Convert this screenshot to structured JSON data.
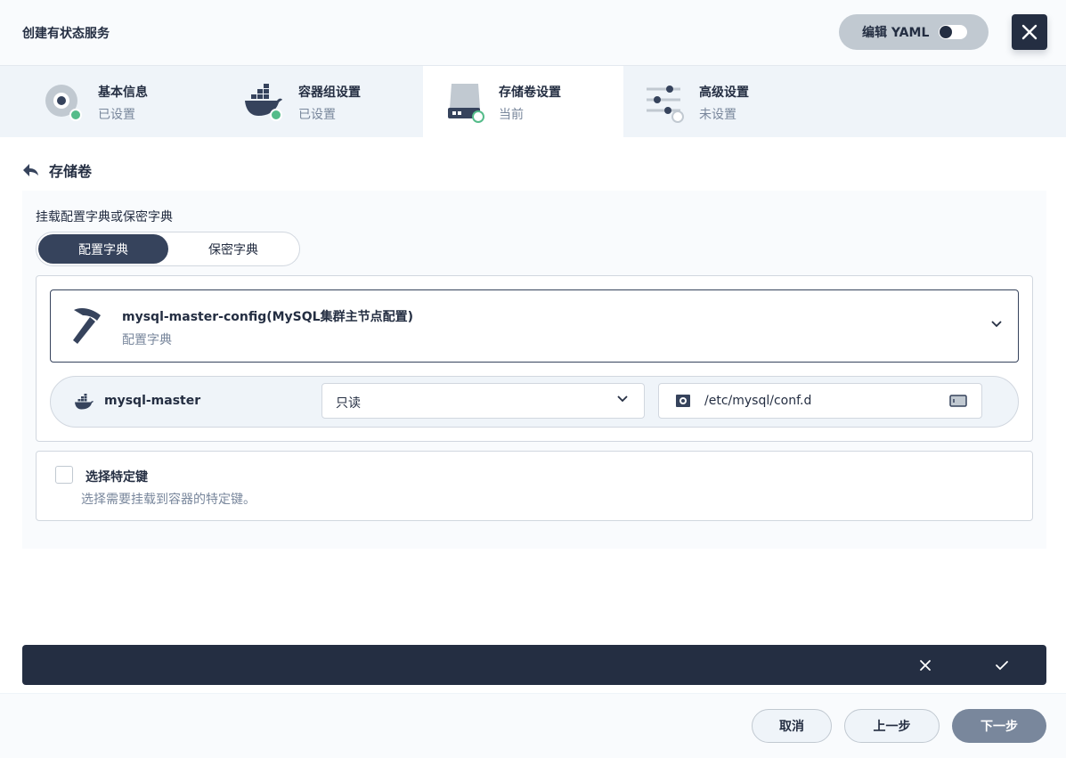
{
  "header": {
    "title": "创建有状态服务",
    "yaml_label": "编辑 YAML"
  },
  "steps": [
    {
      "title": "基本信息",
      "status": "已设置",
      "icon": "info-disc-icon"
    },
    {
      "title": "容器组设置",
      "status": "已设置",
      "icon": "docker-icon"
    },
    {
      "title": "存储卷设置",
      "status": "当前",
      "icon": "storage-drive-icon"
    },
    {
      "title": "高级设置",
      "status": "未设置",
      "icon": "sliders-icon"
    }
  ],
  "volume": {
    "back_title": "存储卷",
    "mount_label": "挂载配置字典或保密字典",
    "tabs": [
      "配置字典",
      "保密字典"
    ],
    "selected": {
      "name": "mysql-master-config(MySQL集群主节点配置)",
      "type": "配置字典",
      "icon": "hammer-icon"
    },
    "container": {
      "name": "mysql-master",
      "access_mode": "只读",
      "mount_path": "/etc/mysql/conf.d"
    },
    "specific_keys": {
      "title": "选择特定键",
      "description": "选择需要挂载到容器的特定键。"
    }
  },
  "footer": {
    "cancel": "取消",
    "prev": "上一步",
    "next": "下一步"
  },
  "colors": {
    "primary_dark": "#242e42",
    "success": "#55bc8a",
    "muted": "#79879c",
    "border": "#d1d7df"
  }
}
